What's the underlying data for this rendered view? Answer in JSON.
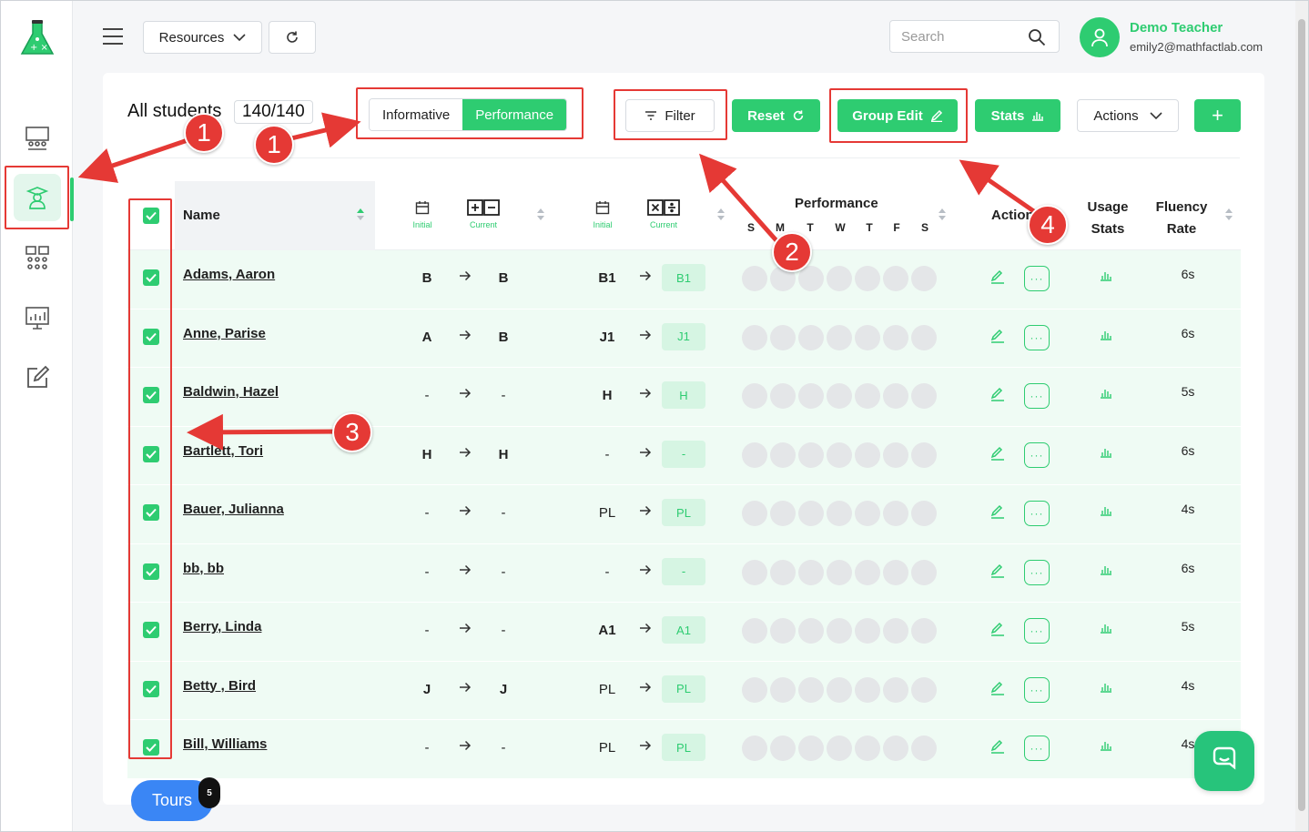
{
  "topbar": {
    "resources_label": "Resources",
    "search_placeholder": "Search",
    "user_name": "Demo Teacher",
    "user_email": "emily2@mathfactlab.com"
  },
  "card": {
    "title": "All students",
    "count": "140/140",
    "toggle": {
      "informative": "Informative",
      "performance": "Performance"
    },
    "filter_label": "Filter",
    "reset_label": "Reset",
    "group_edit_label": "Group Edit",
    "stats_label": "Stats",
    "actions_label": "Actions",
    "add_label": "+"
  },
  "table": {
    "headers": {
      "name": "Name",
      "initial": "Initial",
      "current": "Current",
      "performance": "Performance",
      "days": [
        "S",
        "M",
        "T",
        "W",
        "T",
        "F",
        "S"
      ],
      "action": "Action",
      "usage_stats_1": "Usage",
      "usage_stats_2": "Stats",
      "fluency_rate_1": "Fluency",
      "fluency_rate_2": "Rate"
    },
    "rows": [
      {
        "name": "Adams, Aaron",
        "as_initial": "B",
        "as_current": "B",
        "md_initial": "B1",
        "md_current": "B1",
        "rate": "6s"
      },
      {
        "name": "Anne, Parise",
        "as_initial": "A",
        "as_current": "B",
        "md_initial": "J1",
        "md_current": "J1",
        "rate": "6s"
      },
      {
        "name": "Baldwin, Hazel",
        "as_initial": "-",
        "as_current": "-",
        "md_initial": "H",
        "md_current": "H",
        "rate": "5s"
      },
      {
        "name": "Bartlett, Tori",
        "as_initial": "H",
        "as_current": "H",
        "md_initial": "-",
        "md_current": "-",
        "rate": "6s"
      },
      {
        "name": "Bauer, Julianna",
        "as_initial": "-",
        "as_current": "-",
        "md_initial": "PL",
        "md_current": "PL",
        "rate": "4s"
      },
      {
        "name": "bb, bb",
        "as_initial": "-",
        "as_current": "-",
        "md_initial": "-",
        "md_current": "-",
        "rate": "6s"
      },
      {
        "name": "Berry, Linda",
        "as_initial": "-",
        "as_current": "-",
        "md_initial": "A1",
        "md_current": "A1",
        "rate": "5s"
      },
      {
        "name": "Betty , Bird",
        "as_initial": "J",
        "as_current": "J",
        "md_initial": "PL",
        "md_current": "PL",
        "rate": "4s"
      },
      {
        "name": "Bill, Williams",
        "as_initial": "-",
        "as_current": "-",
        "md_initial": "PL",
        "md_current": "PL",
        "rate": "4s"
      }
    ]
  },
  "annotations": {
    "n1": "1",
    "n1b": "1",
    "n2": "2",
    "n3": "3",
    "n4": "4",
    "color": "#e53935"
  },
  "floating": {
    "tours_label": "Tours",
    "tours_badge": "5"
  },
  "colors": {
    "brand_green": "#2ecc71",
    "row_bg": "#effbf4",
    "tours_blue": "#3a86f5"
  }
}
